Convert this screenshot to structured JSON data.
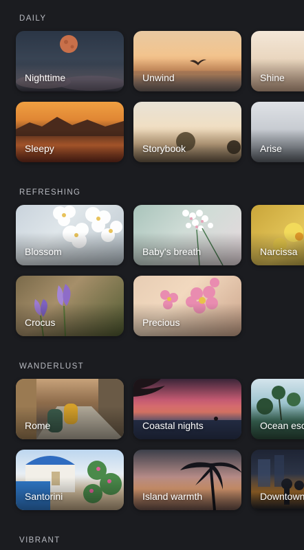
{
  "sections": [
    {
      "title": "DAILY",
      "rows": [
        [
          "Nighttime",
          "Unwind",
          "Shine"
        ],
        [
          "Sleepy",
          "Storybook",
          "Arise"
        ]
      ]
    },
    {
      "title": "REFRESHING",
      "rows": [
        [
          "Blossom",
          "Baby's breath",
          "Narcissa"
        ],
        [
          "Crocus",
          "Precious"
        ]
      ]
    },
    {
      "title": "WANDERLUST",
      "rows": [
        [
          "Rome",
          "Coastal nights",
          "Ocean escape"
        ],
        [
          "Santorini",
          "Island warmth",
          "Downtown"
        ]
      ]
    },
    {
      "title": "VIBRANT",
      "rows": []
    }
  ],
  "colors": {
    "background": "#1b1c20",
    "section_title": "#b9bbc2",
    "card_label": "#ffffff"
  }
}
